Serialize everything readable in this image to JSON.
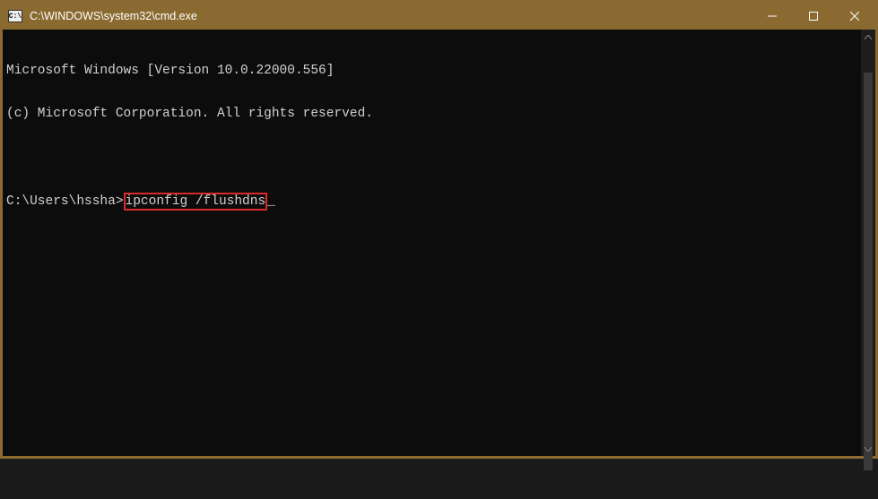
{
  "titlebar": {
    "icon_label": "cmd-icon",
    "icon_text": "C:\\",
    "title": "C:\\WINDOWS\\system32\\cmd.exe",
    "controls": {
      "minimize": "minimize",
      "maximize": "maximize",
      "close": "close"
    }
  },
  "terminal": {
    "line1": "Microsoft Windows [Version 10.0.22000.556]",
    "line2": "(c) Microsoft Corporation. All rights reserved.",
    "prompt": "C:\\Users\\hssha>",
    "command": "ipconfig /flushdns",
    "cursor": "_"
  },
  "colors": {
    "titlebar_bg": "#8a6a30",
    "terminal_bg": "#0c0c0c",
    "text": "#d0d0d0",
    "highlight_border": "#d82a2a"
  }
}
